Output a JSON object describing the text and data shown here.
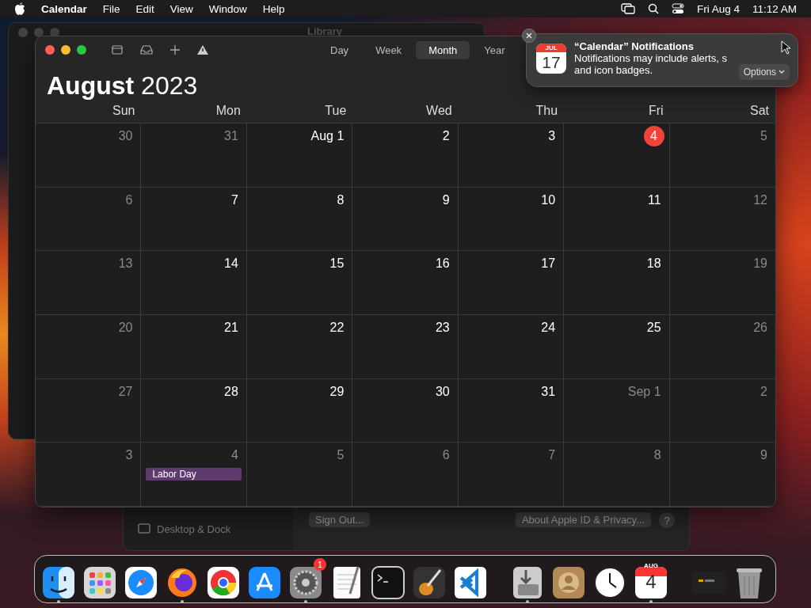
{
  "menu_bar": {
    "app": "Calendar",
    "menus": [
      "File",
      "Edit",
      "View",
      "Window",
      "Help"
    ],
    "date": "Fri Aug 4",
    "time": "11:12 AM"
  },
  "background_window": {
    "title": "Library"
  },
  "settings_window": {
    "sidebar_item": "Desktop & Dock",
    "buttons": [
      "Sign Out...",
      "About Apple ID & Privacy..."
    ],
    "help": "?"
  },
  "calendar": {
    "views": [
      {
        "label": "Day",
        "selected": false
      },
      {
        "label": "Week",
        "selected": false
      },
      {
        "label": "Month",
        "selected": true
      },
      {
        "label": "Year",
        "selected": false
      }
    ],
    "month": "August",
    "year": "2023",
    "weekdays": [
      "Sun",
      "Mon",
      "Tue",
      "Wed",
      "Thu",
      "Fri",
      "Sat"
    ],
    "weeks": [
      [
        {
          "day": "30",
          "dimmed": true,
          "today": false
        },
        {
          "day": "31",
          "dimmed": true,
          "today": false
        },
        {
          "day": "Aug 1",
          "dimmed": false,
          "today": false
        },
        {
          "day": "2",
          "dimmed": false,
          "today": false
        },
        {
          "day": "3",
          "dimmed": false,
          "today": false
        },
        {
          "day": "4",
          "dimmed": false,
          "today": true
        },
        {
          "day": "5",
          "dimmed": true,
          "today": false
        }
      ],
      [
        {
          "day": "6",
          "dimmed": true,
          "today": false
        },
        {
          "day": "7",
          "dimmed": false,
          "today": false
        },
        {
          "day": "8",
          "dimmed": false,
          "today": false
        },
        {
          "day": "9",
          "dimmed": false,
          "today": false
        },
        {
          "day": "10",
          "dimmed": false,
          "today": false
        },
        {
          "day": "11",
          "dimmed": false,
          "today": false
        },
        {
          "day": "12",
          "dimmed": true,
          "today": false
        }
      ],
      [
        {
          "day": "13",
          "dimmed": true,
          "today": false
        },
        {
          "day": "14",
          "dimmed": false,
          "today": false
        },
        {
          "day": "15",
          "dimmed": false,
          "today": false
        },
        {
          "day": "16",
          "dimmed": false,
          "today": false
        },
        {
          "day": "17",
          "dimmed": false,
          "today": false
        },
        {
          "day": "18",
          "dimmed": false,
          "today": false
        },
        {
          "day": "19",
          "dimmed": true,
          "today": false
        }
      ],
      [
        {
          "day": "20",
          "dimmed": true,
          "today": false
        },
        {
          "day": "21",
          "dimmed": false,
          "today": false
        },
        {
          "day": "22",
          "dimmed": false,
          "today": false
        },
        {
          "day": "23",
          "dimmed": false,
          "today": false
        },
        {
          "day": "24",
          "dimmed": false,
          "today": false
        },
        {
          "day": "25",
          "dimmed": false,
          "today": false
        },
        {
          "day": "26",
          "dimmed": true,
          "today": false
        }
      ],
      [
        {
          "day": "27",
          "dimmed": true,
          "today": false
        },
        {
          "day": "28",
          "dimmed": false,
          "today": false
        },
        {
          "day": "29",
          "dimmed": false,
          "today": false
        },
        {
          "day": "30",
          "dimmed": false,
          "today": false
        },
        {
          "day": "31",
          "dimmed": false,
          "today": false
        },
        {
          "day": "Sep 1",
          "dimmed": true,
          "today": false
        },
        {
          "day": "2",
          "dimmed": true,
          "today": false
        }
      ],
      [
        {
          "day": "3",
          "dimmed": true,
          "today": false
        },
        {
          "day": "4",
          "dimmed": true,
          "today": false,
          "events": [
            {
              "title": "Labor Day",
              "color": "#5e3a6e"
            }
          ]
        },
        {
          "day": "5",
          "dimmed": true,
          "today": false
        },
        {
          "day": "6",
          "dimmed": true,
          "today": false
        },
        {
          "day": "7",
          "dimmed": true,
          "today": false
        },
        {
          "day": "8",
          "dimmed": true,
          "today": false
        },
        {
          "day": "9",
          "dimmed": true,
          "today": false
        }
      ]
    ]
  },
  "notification": {
    "title": "“Calendar” Notifications",
    "lines": [
      "Notifications may include alerts, s",
      "and icon badges."
    ],
    "icon_month": "JUL",
    "icon_day": "17",
    "options": "Options"
  },
  "dock": [
    {
      "kind": "finder",
      "running": true
    },
    {
      "kind": "launchpad",
      "running": false
    },
    {
      "kind": "safari",
      "running": false
    },
    {
      "kind": "firefox",
      "running": true
    },
    {
      "kind": "chrome",
      "running": false
    },
    {
      "kind": "appstore",
      "running": false
    },
    {
      "kind": "settings",
      "running": true,
      "badge": "1"
    },
    {
      "kind": "textedit",
      "running": false
    },
    {
      "kind": "terminal",
      "running": false
    },
    {
      "kind": "guitar",
      "running": false
    },
    {
      "kind": "vscode",
      "running": false
    },
    {
      "kind": "separator"
    },
    {
      "kind": "installer",
      "running": true
    },
    {
      "kind": "contacts",
      "running": false
    },
    {
      "kind": "clock",
      "running": false
    },
    {
      "kind": "calendar",
      "running": true,
      "month": "AUG",
      "day": "4"
    },
    {
      "kind": "separator"
    },
    {
      "kind": "window",
      "running": false
    },
    {
      "kind": "trash",
      "running": false
    }
  ]
}
